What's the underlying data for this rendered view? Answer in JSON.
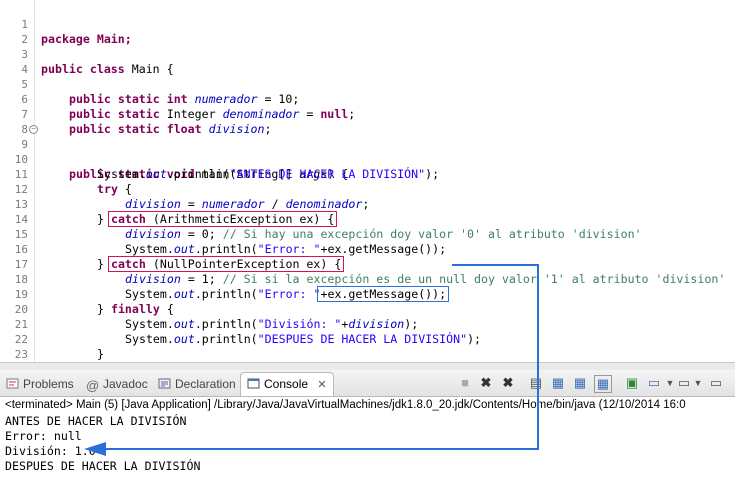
{
  "editor": {
    "lines": {
      "l1": {
        "n": "1",
        "t": [
          "package Main;"
        ]
      },
      "l2": {
        "n": "2"
      },
      "l3": {
        "n": "3",
        "t": [
          "public class",
          " Main {"
        ]
      },
      "l4": {
        "n": "4"
      },
      "l5": {
        "n": "5",
        "t": [
          "public static int",
          "numerador",
          " = 10;"
        ]
      },
      "l6": {
        "n": "6",
        "t": [
          "public static",
          " Integer ",
          "denominador",
          " = ",
          "null",
          ";"
        ]
      },
      "l7": {
        "n": "7",
        "t": [
          "public static float",
          "division",
          ";"
        ]
      },
      "l8": {
        "n": "8"
      },
      "l9": {
        "n": "9",
        "t": [
          "public static void",
          " main(String[] ",
          "args",
          ") {"
        ]
      },
      "l10": {
        "n": "10",
        "t": [
          "System.",
          "out",
          ".println(",
          "\"ANTES DE HACER LA DIVISIÓN\"",
          ");"
        ]
      },
      "l11": {
        "n": "11",
        "t": [
          "try",
          " {"
        ]
      },
      "l12": {
        "n": "12",
        "t": [
          "division",
          " = ",
          "numerador",
          " / ",
          "denominador",
          ";"
        ]
      },
      "l13": {
        "n": "13",
        "t": [
          "} ",
          "catch",
          " (ArithmeticException ex) {"
        ]
      },
      "l14": {
        "n": "14",
        "t": [
          "division",
          " = 0; ",
          "// Si hay una excepción doy valor '0' al atributo 'division'"
        ]
      },
      "l15": {
        "n": "15",
        "t": [
          "System.",
          "out",
          ".println(",
          "\"Error: \"",
          "+ex.getMessage());"
        ]
      },
      "l16": {
        "n": "16",
        "t": [
          "} ",
          "catch",
          " (NullPointerException ex) {"
        ]
      },
      "l17": {
        "n": "17",
        "t": [
          "division",
          " = 1; ",
          "// Si si la excepción es de un null doy valor '1' al atributo 'division'"
        ]
      },
      "l18": {
        "n": "18",
        "t": [
          "System.",
          "out",
          ".println(",
          "\"Error: \"",
          "+ex.getMessage());"
        ]
      },
      "l19": {
        "n": "19",
        "t": [
          "} ",
          "finally",
          " {"
        ]
      },
      "l20": {
        "n": "20",
        "t": [
          "System.",
          "out",
          ".println(",
          "\"División: \"",
          "+",
          "division",
          ");"
        ]
      },
      "l21": {
        "n": "21",
        "t": [
          "System.",
          "out",
          ".println(",
          "\"DESPUES DE HACER LA DIVISIÓN\"",
          ");"
        ]
      },
      "l22": {
        "n": "22",
        "t": [
          "}"
        ]
      },
      "l23": {
        "n": "23",
        "t": [
          "}"
        ]
      },
      "l24": {
        "n": "24",
        "t": [
          "}"
        ]
      }
    }
  },
  "tabs": {
    "problems": "Problems",
    "javadoc": "Javadoc",
    "declaration": "Declaration",
    "console": "Console"
  },
  "console": {
    "header": "<terminated> Main (5) [Java Application] /Library/Java/JavaVirtualMachines/jdk1.8.0_20.jdk/Contents/Home/bin/java (12/10/2014 16:0",
    "output": [
      "ANTES DE HACER LA DIVISIÓN",
      "Error: null",
      "División: 1.0",
      "DESPUES DE HACER LA DIVISIÓN"
    ]
  },
  "colors": {
    "keyword": "#7f0055",
    "field": "#0000c0",
    "string": "#2a00ff",
    "comment": "#3f7f5f",
    "highlight_red": "#d4145a",
    "highlight_blue": "#2b6fd8"
  },
  "icons": [
    "problems-icon",
    "javadoc-icon",
    "declaration-icon",
    "console-icon",
    "terminate-icon",
    "remove-launch-icon",
    "remove-all-icon",
    "scroll-lock-icon",
    "pin-console-icon",
    "display-console-icon",
    "open-console-icon"
  ]
}
